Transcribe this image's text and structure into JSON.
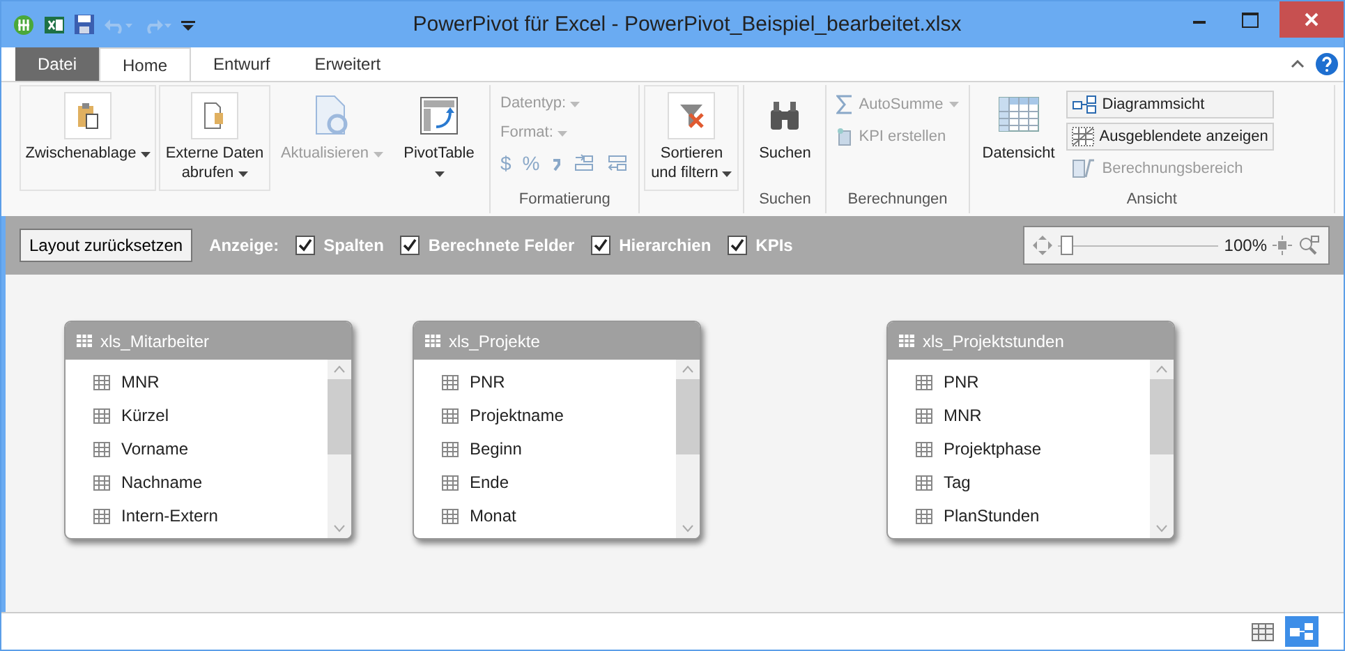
{
  "window": {
    "title": "PowerPivot für Excel - PowerPivot_Beispiel_bearbeitet.xlsx"
  },
  "tabs": [
    {
      "label": "Datei",
      "kind": "file",
      "selected": false
    },
    {
      "label": "Home",
      "kind": "tab",
      "selected": true
    },
    {
      "label": "Entwurf",
      "kind": "tab",
      "selected": false
    },
    {
      "label": "Erweitert",
      "kind": "tab",
      "selected": false
    }
  ],
  "ribbon": {
    "groups": [
      {
        "items": [
          {
            "kind": "large",
            "label": "Zwischenablage",
            "dropdown": true,
            "disabled": false
          },
          {
            "kind": "large",
            "label": "Externe Daten abrufen",
            "dropdown": true,
            "disabled": false
          },
          {
            "kind": "large",
            "label": "Aktualisieren",
            "dropdown": true,
            "disabled": true
          },
          {
            "kind": "large",
            "label": "PivotTable",
            "dropdown": true,
            "disabled": false
          }
        ]
      },
      {
        "label": "Formatierung",
        "items": [
          {
            "kind": "stack",
            "entries": [
              {
                "kind": "field",
                "label": "Datentyp:",
                "disabled": true
              },
              {
                "kind": "field",
                "label": "Format:",
                "disabled": true
              },
              {
                "kind": "numfmt",
                "symbols": [
                  "$",
                  "%"
                ],
                "disabled": true
              }
            ]
          }
        ]
      },
      {
        "items": [
          {
            "kind": "large",
            "label": "Sortieren und filtern",
            "dropdown": true,
            "disabled": false
          }
        ]
      },
      {
        "label": "Suchen",
        "items": [
          {
            "kind": "large",
            "label": "Suchen",
            "dropdown": false,
            "disabled": false
          }
        ]
      },
      {
        "label": "Berechnungen",
        "items": [
          {
            "kind": "stack",
            "entries": [
              {
                "kind": "small",
                "label": "AutoSumme",
                "dropdown": true,
                "disabled": true,
                "selected": false
              },
              {
                "kind": "small",
                "label": "KPI erstellen",
                "dropdown": false,
                "disabled": true,
                "selected": false
              }
            ]
          }
        ]
      },
      {
        "label": "Ansicht",
        "items": [
          {
            "kind": "large",
            "label": "Datensicht",
            "dropdown": false,
            "disabled": false
          },
          {
            "kind": "stack",
            "entries": [
              {
                "kind": "small",
                "label": "Diagrammsicht",
                "dropdown": false,
                "disabled": false,
                "selected": true
              },
              {
                "kind": "small",
                "label": "Ausgeblendete anzeigen",
                "dropdown": false,
                "disabled": false,
                "selected": true
              },
              {
                "kind": "small",
                "label": "Berechnungsbereich",
                "dropdown": false,
                "disabled": true,
                "selected": false
              }
            ]
          }
        ]
      }
    ]
  },
  "toolbar": {
    "reset_button": "Layout zurücksetzen",
    "display_label": "Anzeige:",
    "checkboxes": [
      {
        "label": "Spalten",
        "checked": true
      },
      {
        "label": "Berechnete Felder",
        "checked": true
      },
      {
        "label": "Hierarchien",
        "checked": true
      },
      {
        "label": "KPIs",
        "checked": true
      }
    ],
    "zoom": {
      "level": 0.02,
      "reading": "100%"
    }
  },
  "tables": [
    {
      "title": "xls_Mitarbeiter",
      "fields": [
        "MNR",
        "Kürzel",
        "Vorname",
        "Nachname",
        "Intern-Extern"
      ]
    },
    {
      "title": "xls_Projekte",
      "fields": [
        "PNR",
        "Projektname",
        "Beginn",
        "Ende",
        "Monat"
      ]
    },
    {
      "title": "xls_Projektstunden",
      "fields": [
        "PNR",
        "MNR",
        "Projektphase",
        "Tag",
        "PlanStunden"
      ]
    }
  ],
  "status_bar": {
    "views": [
      {
        "kind": "grid",
        "selected": false
      },
      {
        "kind": "diagram",
        "selected": true
      }
    ]
  }
}
